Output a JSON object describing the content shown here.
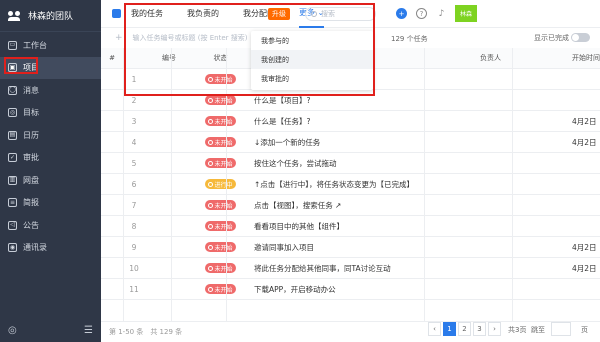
{
  "sidebar": {
    "team": "林森的团队",
    "items": [
      {
        "label": "工作台",
        "icon": "desk-icon"
      },
      {
        "label": "项目",
        "icon": "project-icon"
      },
      {
        "label": "消息",
        "icon": "message-icon"
      },
      {
        "label": "目标",
        "icon": "target-icon"
      },
      {
        "label": "日历",
        "icon": "calendar-icon"
      },
      {
        "label": "审批",
        "icon": "approval-icon"
      },
      {
        "label": "网盘",
        "icon": "drive-icon"
      },
      {
        "label": "简报",
        "icon": "report-icon"
      },
      {
        "label": "公告",
        "icon": "notice-icon"
      },
      {
        "label": "通讯录",
        "icon": "contacts-icon"
      }
    ],
    "bottom_left": "◎",
    "bottom_right": "☰"
  },
  "topbar": {
    "tabs": [
      "我的任务",
      "我负责的",
      "我分配的",
      "更多"
    ],
    "upgrade": "升级",
    "search_placeholder": "搜索",
    "add_icon": "+",
    "help_icon": "?",
    "bell_icon": "♪",
    "avatar_text": "林森"
  },
  "toolbar": {
    "plus": "+",
    "placeholder": "输入任务编号或标题 (按 Enter 搜索)",
    "count": "129 个任务",
    "show_done": "显示已完成"
  },
  "dropdown": {
    "items": [
      "我参与的",
      "我创建的",
      "我审批的"
    ],
    "selected": 1
  },
  "table": {
    "headers": {
      "select": "#",
      "no": "编号",
      "status": "状态",
      "owner": "负责人",
      "start": "开始时间"
    },
    "status_labels": {
      "notstart": "未开始",
      "progress": "进行中"
    },
    "rows": [
      {
        "idx": "1",
        "status": "notstart",
        "title": "",
        "start": ""
      },
      {
        "idx": "2",
        "status": "notstart",
        "title": "什么是【项目】?",
        "start": ""
      },
      {
        "idx": "3",
        "status": "notstart",
        "title": "什么是【任务】?",
        "start": "4月2日"
      },
      {
        "idx": "4",
        "status": "notstart",
        "title": "↓添加一个新的任务",
        "start": "4月2日"
      },
      {
        "idx": "5",
        "status": "notstart",
        "title": "按住这个任务，尝试拖动",
        "start": ""
      },
      {
        "idx": "6",
        "status": "progress",
        "title": "↑点击【进行中】，将任务状态变更为【已完成】",
        "start": ""
      },
      {
        "idx": "7",
        "status": "notstart",
        "title": "点击【视图】，搜索任务 ↗",
        "start": ""
      },
      {
        "idx": "8",
        "status": "notstart",
        "title": "看看项目中的其他【组件】",
        "start": ""
      },
      {
        "idx": "9",
        "status": "notstart",
        "title": "邀请同事加入项目",
        "start": "4月2日"
      },
      {
        "idx": "10",
        "status": "notstart",
        "title": "将此任务分配给其他同事，同TA讨论互动",
        "start": "4月2日"
      },
      {
        "idx": "11",
        "status": "notstart",
        "title": "下载APP，开启移动办公",
        "start": ""
      }
    ]
  },
  "footer": {
    "total": "第 1-50 条　共 129 条",
    "pages": [
      "‹",
      "1",
      "2",
      "3",
      "›"
    ],
    "current": "1",
    "total_pages": "共3页",
    "jump": "跳至",
    "page_word": "页"
  },
  "colors": {
    "accent": "#2b7bea",
    "sidebar": "#2f3747",
    "notstart": "#ef6a6a",
    "progress": "#f6b93b",
    "highlight": "#e0201c",
    "upgrade": "#ff6a00"
  }
}
